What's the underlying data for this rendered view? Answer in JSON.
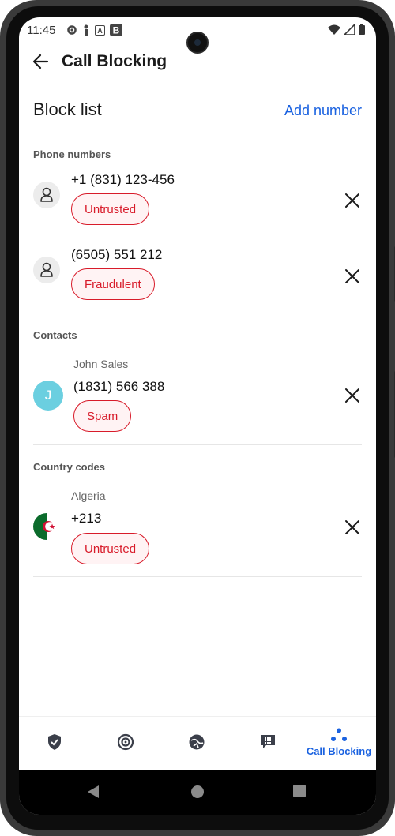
{
  "status_bar": {
    "time": "11:45"
  },
  "app_bar": {
    "title": "Call Blocking",
    "back_icon": "arrow-left-icon"
  },
  "block_list": {
    "heading": "Block list",
    "add_label": "Add number"
  },
  "phone_numbers": {
    "label": "Phone numbers",
    "items": [
      {
        "number": "+1 (831) 123-456",
        "tag": "Untrusted"
      },
      {
        "number": "(6505) 551 212",
        "tag": "Fraudulent"
      }
    ]
  },
  "contacts": {
    "label": "Contacts",
    "items": [
      {
        "name": "John Sales",
        "initial": "J",
        "number": "(1831) 566 388",
        "tag": "Spam"
      }
    ]
  },
  "country_codes": {
    "label": "Country codes",
    "items": [
      {
        "country": "Algeria",
        "code": "+213",
        "tag": "Untrusted"
      }
    ]
  },
  "bottom_nav": {
    "items": [
      {
        "icon": "shield-check-icon"
      },
      {
        "icon": "target-icon"
      },
      {
        "icon": "globe-icon"
      },
      {
        "icon": "chat-alert-icon"
      },
      {
        "icon": "dots-icon",
        "label": "Call Blocking",
        "active": true
      }
    ]
  },
  "colors": {
    "accent": "#1a62e0",
    "danger": "#d81b2a",
    "avatar": "#6bcfe0"
  }
}
